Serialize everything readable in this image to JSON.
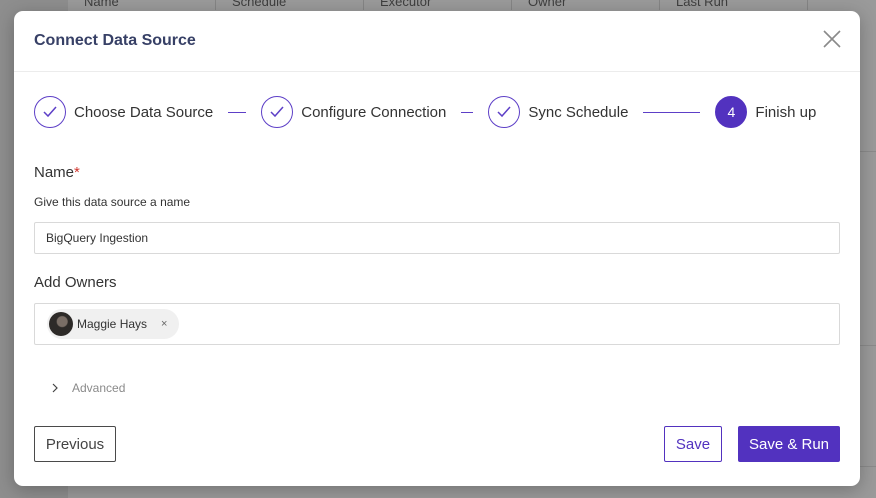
{
  "background": {
    "columns": [
      "Name",
      "Schedule",
      "Executor",
      "Owner",
      "Last Run"
    ]
  },
  "modal": {
    "title": "Connect Data Source",
    "close_icon": "close-icon"
  },
  "steps": [
    {
      "label": "Choose Data Source",
      "status": "done"
    },
    {
      "label": "Configure Connection",
      "status": "done"
    },
    {
      "label": "Sync Schedule",
      "status": "done"
    },
    {
      "label": "Finish up",
      "status": "active",
      "number": "4"
    }
  ],
  "form": {
    "name_label": "Name",
    "required_mark": "*",
    "name_description": "Give this data source a name",
    "name_value": "BigQuery Ingestion",
    "owners_label": "Add Owners",
    "owners": [
      {
        "name": "Maggie Hays",
        "remove": "×"
      }
    ],
    "advanced_label": "Advanced"
  },
  "footer": {
    "previous_label": "Previous",
    "save_label": "Save",
    "save_run_label": "Save & Run"
  },
  "colors": {
    "accent": "#5232bf",
    "title": "#374066"
  }
}
